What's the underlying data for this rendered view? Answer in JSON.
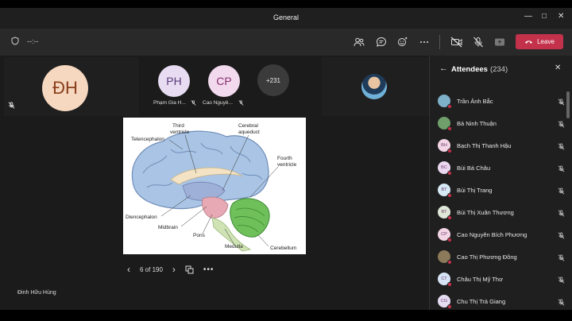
{
  "window": {
    "title": "General"
  },
  "toolbar": {
    "timer": "--:--",
    "leave_label": "Leave"
  },
  "tiles": {
    "big": {
      "initials": "ĐH"
    },
    "people": [
      {
        "initials": "PH",
        "name": "Phạm Gia H...",
        "bg": "#e8dcf2",
        "fg": "#5a3a7a"
      },
      {
        "initials": "CP",
        "name": "Cao Nguyê...",
        "bg": "#f2d9ee",
        "fg": "#8a2f6e"
      }
    ],
    "more": "+231"
  },
  "slide": {
    "labels": {
      "third_ventricle_1": "Third",
      "third_ventricle_2": "ventricle",
      "cerebral_aqueduct_1": "Cerebral",
      "cerebral_aqueduct_2": "aqueduct",
      "telencephalon": "Telencephalon",
      "fourth_ventricle_1": "Fourth",
      "fourth_ventricle_2": "ventricle",
      "diencephalon": "Diencephalon",
      "midbrain": "Midbrain",
      "pons": "Pons",
      "medulla": "Medulla",
      "cerebellum": "Cerebellum"
    }
  },
  "pager": {
    "label": "6 of 190"
  },
  "presenter": {
    "name": "Đinh Hữu Hùng"
  },
  "attendees": {
    "title": "Attendees",
    "count": "(234)",
    "items": [
      {
        "name": "Trần Ánh Bắc",
        "initials": "",
        "bg": "#7fb0c9"
      },
      {
        "name": "Bá Ninh Thuận",
        "initials": "",
        "bg": "#6f9f6a"
      },
      {
        "name": "Bạch Thị Thanh Hậu",
        "initials": "BH",
        "bg": "#f3d6e6"
      },
      {
        "name": "Bùi Bá Châu",
        "initials": "BC",
        "bg": "#ecd7f1"
      },
      {
        "name": "Bùi Thị Trang",
        "initials": "BT",
        "bg": "#d6e9f5"
      },
      {
        "name": "Bùi Thị Xuân Thương",
        "initials": "BT",
        "bg": "#dfe8d8"
      },
      {
        "name": "Cao Nguyên Bích Phương",
        "initials": "CP",
        "bg": "#f3d6e6"
      },
      {
        "name": "Cao Thị Phương Đông",
        "initials": "",
        "bg": "#8a7a5a"
      },
      {
        "name": "Châu Thị Mỹ Thơ",
        "initials": "CT",
        "bg": "#d6e4f5"
      },
      {
        "name": "Chu Thị Trà Giang",
        "initials": "CG",
        "bg": "#e6dcf2"
      }
    ]
  },
  "colors": {
    "accent_red": "#c4314b",
    "panel_bg": "#1f1f1f",
    "stage_bg": "#1b1b1b"
  }
}
